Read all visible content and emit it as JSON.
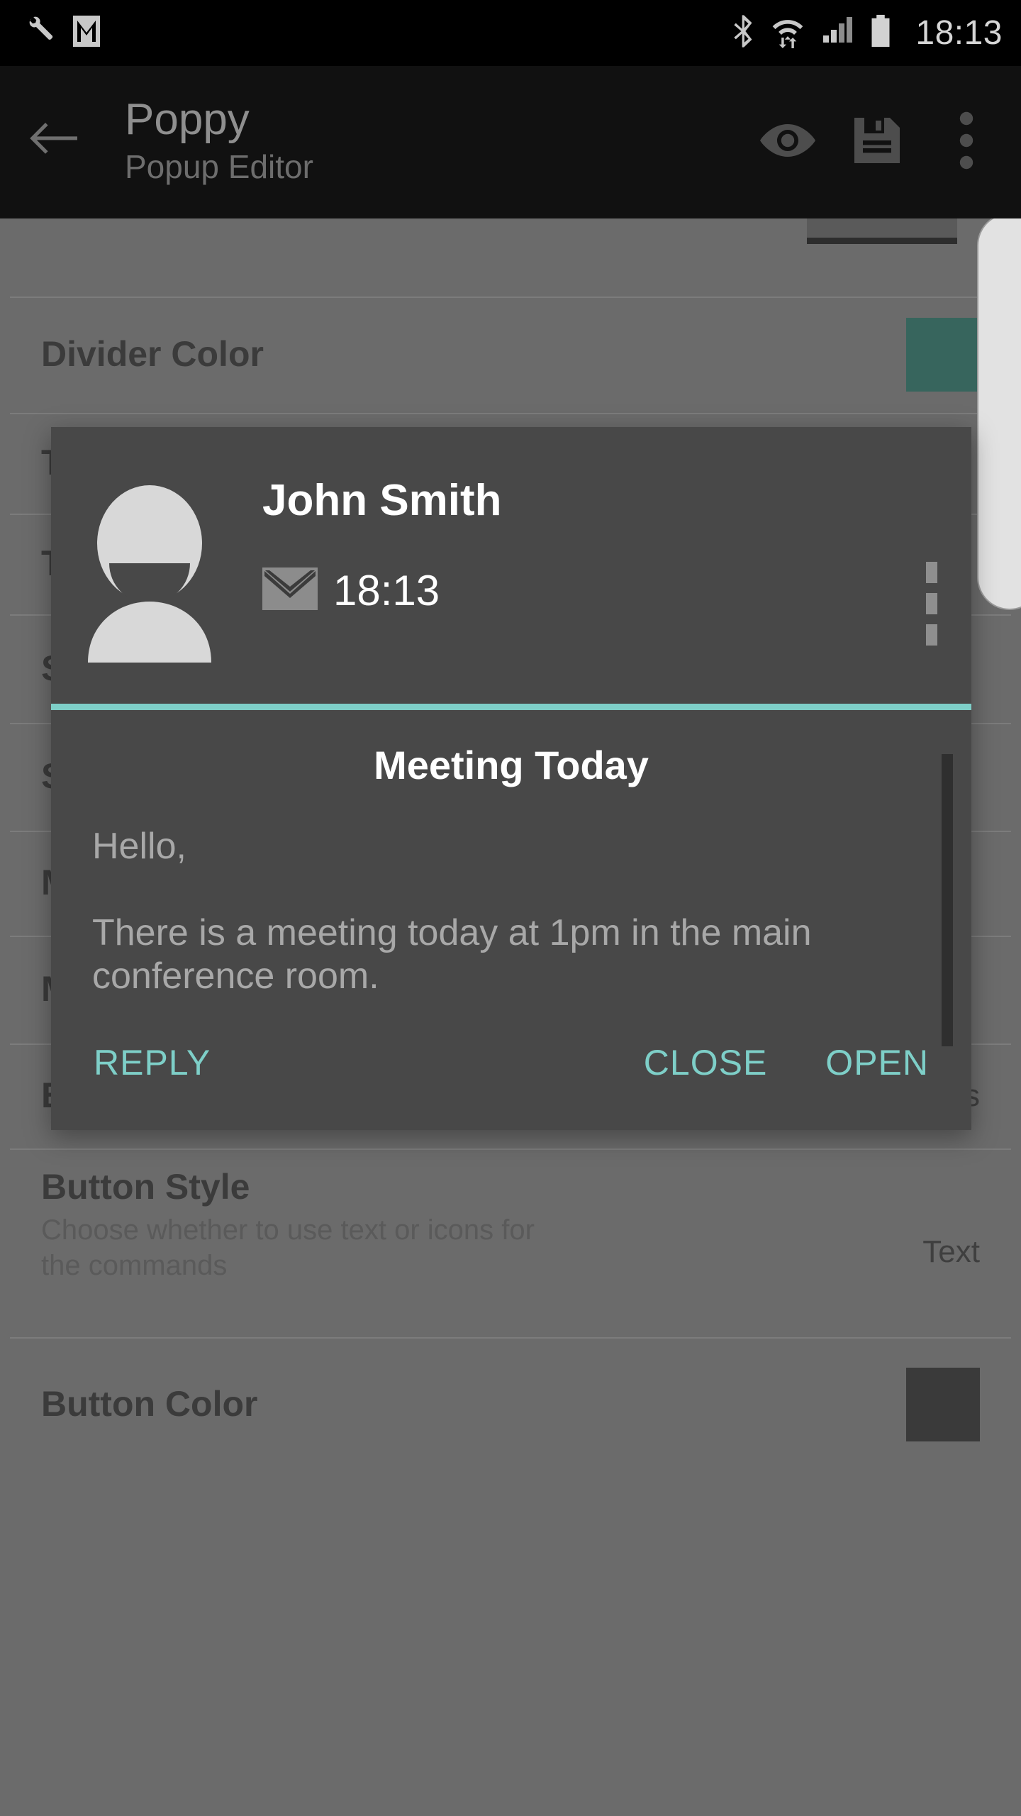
{
  "statusbar": {
    "time": "18:13",
    "icons": [
      "wrench-icon",
      "gmail-icon",
      "bluetooth-icon",
      "wifi-data-icon",
      "signal-icon",
      "battery-icon"
    ]
  },
  "appbar": {
    "back_label": "back-arrow",
    "title": "Poppy",
    "subtitle": "Popup Editor",
    "actions": [
      "preview-eye-icon",
      "save-icon",
      "overflow-menu-icon"
    ]
  },
  "settings": {
    "rows": [
      {
        "title": "",
        "desc": "",
        "value": "",
        "swatch": ""
      },
      {
        "title": "Divider Color",
        "desc": "",
        "value": "",
        "swatch": "#37655d"
      },
      {
        "title": "T",
        "desc": "",
        "value": "",
        "swatch": ""
      },
      {
        "title": "T",
        "desc": "",
        "value": "",
        "swatch": ""
      },
      {
        "title": "S",
        "desc": "",
        "value": "",
        "swatch": ""
      },
      {
        "title": "S",
        "desc": "",
        "value": "",
        "swatch": ""
      },
      {
        "title": "M",
        "desc": "",
        "value": "",
        "swatch": ""
      },
      {
        "title": "M",
        "desc": "",
        "value": "",
        "swatch": ""
      },
      {
        "title": "Button Row Style",
        "desc": "",
        "value": "Minimal Buttons",
        "swatch": ""
      },
      {
        "title": "Button Style",
        "desc": "Choose whether to use text or icons for the commands",
        "value": "Text",
        "swatch": ""
      },
      {
        "title": "Button Color",
        "desc": "",
        "value": "",
        "swatch": "#3a3a3a"
      }
    ]
  },
  "dialog": {
    "sender": "John Smith",
    "time": "18:13",
    "mail_icon": "envelope-icon",
    "menu_icon": "vertical-dots-icon",
    "subject": "Meeting Today",
    "message": "Hello,\n\nThere is a meeting today at 1pm in the main conference room.",
    "buttons": {
      "reply": "REPLY",
      "close": "CLOSE",
      "open": "OPEN"
    },
    "accent_color": "#7ecfc8",
    "background_color": "#484848"
  }
}
